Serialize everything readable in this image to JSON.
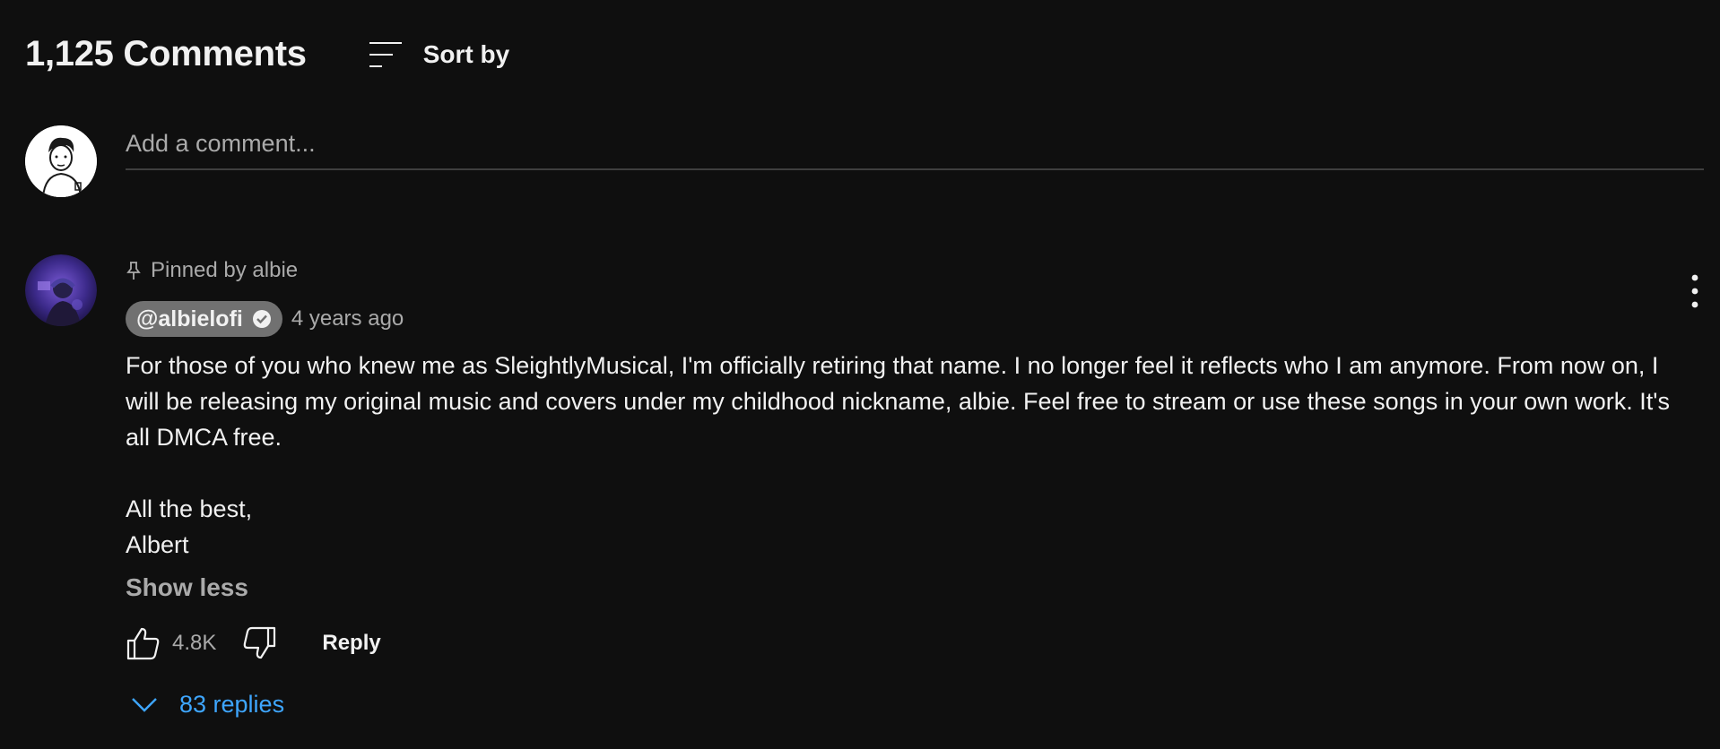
{
  "header": {
    "count_label": "1,125 Comments",
    "sort_label": "Sort by",
    "sort_icon": "sort-icon"
  },
  "add_comment": {
    "placeholder": "Add a comment...",
    "avatar_icon": "user-avatar"
  },
  "comment": {
    "pinned_label": "Pinned by albie",
    "author": "@albielofi",
    "verified_icon": "verified-check-icon",
    "time": "4 years ago",
    "text_paragraph": "For those of you who knew me as SleightlyMusical, I'm officially retiring that name. I no longer feel it reflects who I am anymore. From now on, I will be releasing my original music and covers under my childhood nickname, albie. Feel free to stream or use these songs in your own work. It's all DMCA free.",
    "signoff_line1": "All the best,",
    "signoff_line2": "Albert",
    "show_less_label": "Show less",
    "likes": "4.8K",
    "reply_label": "Reply",
    "replies_label": "83 replies"
  },
  "colors": {
    "background": "#0f0f0f",
    "text": "#f1f1f1",
    "secondary_text": "#aaaaaa",
    "link": "#3ea6ff",
    "author_chip": "#717171",
    "divider": "#3f3f3f"
  }
}
